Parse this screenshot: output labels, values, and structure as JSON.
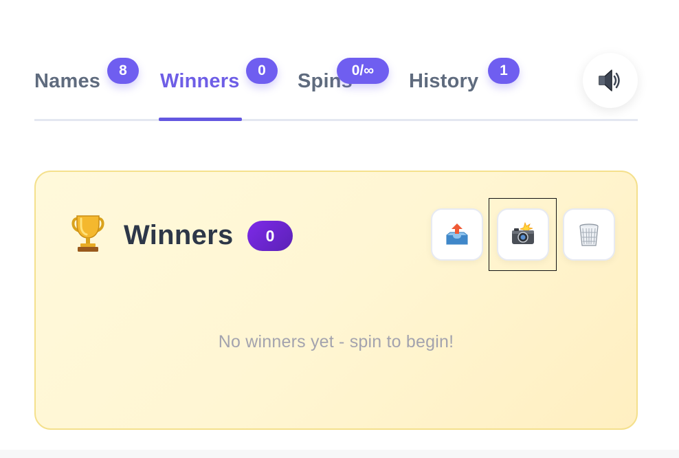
{
  "tabs": [
    {
      "label": "Names",
      "badge": "8"
    },
    {
      "label": "Winners",
      "badge": "0"
    },
    {
      "label": "Spins",
      "badge": "0/∞"
    },
    {
      "label": "History",
      "badge": "1"
    }
  ],
  "active_tab": "Winners",
  "sound_button": {
    "icon": "speaker-icon"
  },
  "winners_panel": {
    "icon": "trophy-icon",
    "title": "Winners",
    "count": "0",
    "actions": [
      {
        "name": "export",
        "icon": "inbox-upload-icon"
      },
      {
        "name": "screenshot",
        "icon": "camera-flash-icon"
      },
      {
        "name": "clear",
        "icon": "wastebasket-icon"
      }
    ],
    "empty_message": "No winners yet - spin to begin!"
  },
  "colors": {
    "accent": "#6f5ef0",
    "tab_inactive": "#5f6b7e",
    "panel_border": "#f4e08c",
    "panel_bg": "#fff6d3",
    "title_text": "#2d3748",
    "muted_text": "#a3a3ae"
  }
}
